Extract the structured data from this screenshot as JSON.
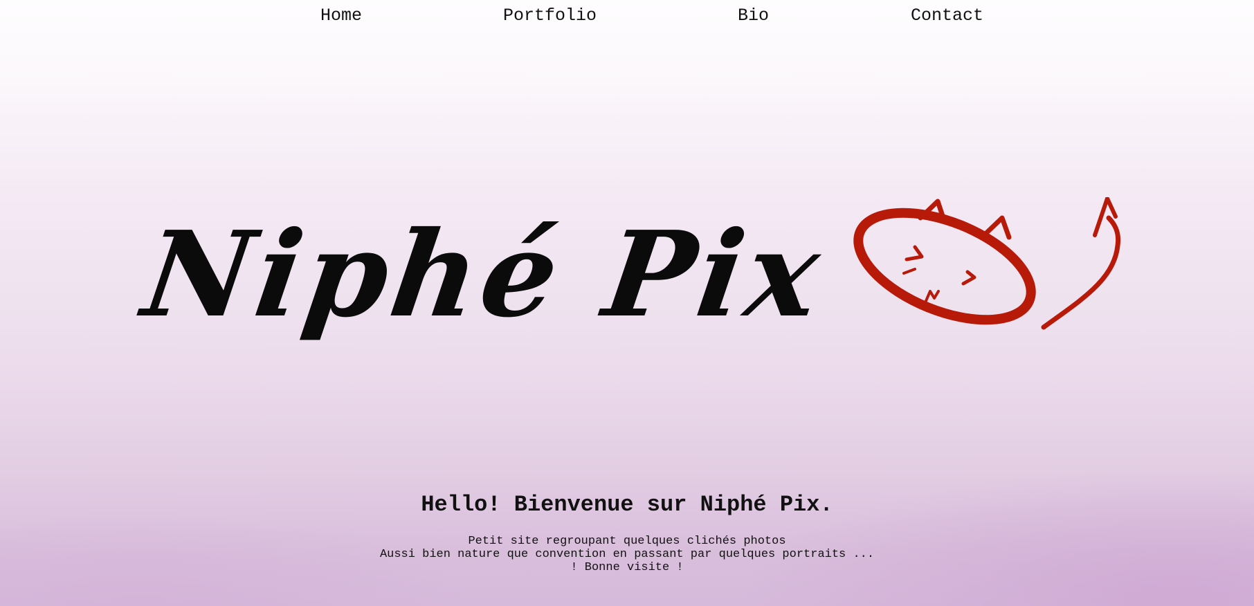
{
  "nav": {
    "items": [
      {
        "label": "Home"
      },
      {
        "label": "Portfolio"
      },
      {
        "label": "Bio"
      },
      {
        "label": "Contact"
      }
    ]
  },
  "logo": {
    "text": "Niphé Pix",
    "mascot_icon": "cat-face-icon",
    "mascot_color": "#b81a0a"
  },
  "main": {
    "heading": "Hello! Bienvenue sur Niphé Pix.",
    "lines": [
      "Petit site regroupant quelques clichés photos",
      "Aussi bien nature que convention en passant par quelques portraits ...",
      "! Bonne visite !"
    ]
  },
  "colors": {
    "text": "#111111",
    "background_bottom": "#d6badb",
    "background_top": "#fefdfe"
  }
}
